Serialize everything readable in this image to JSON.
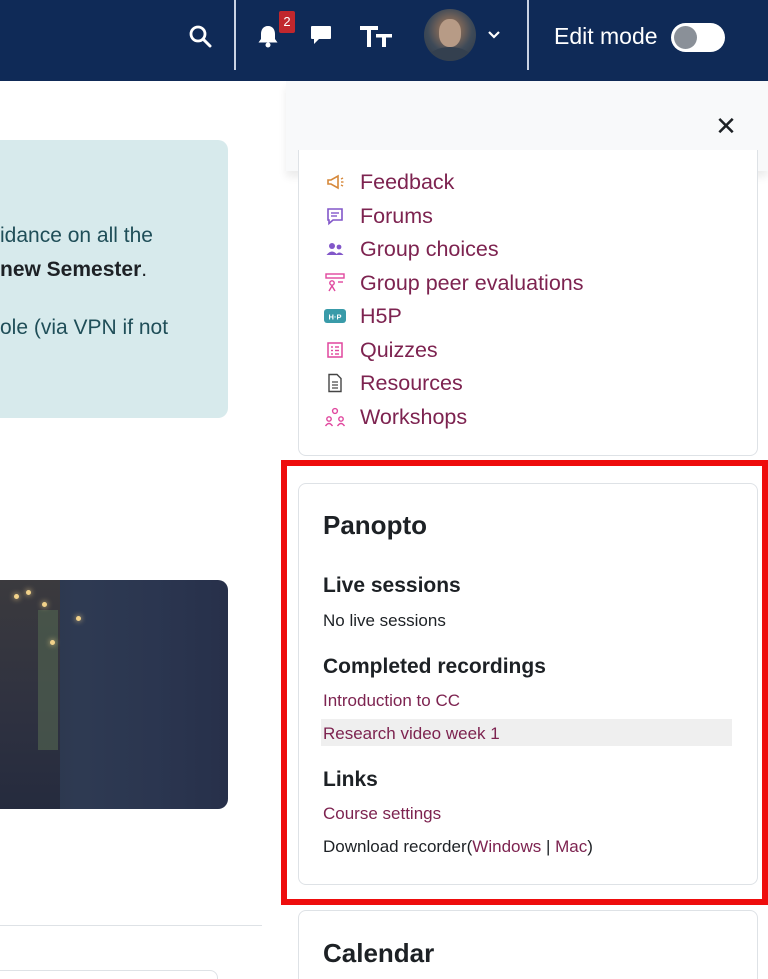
{
  "navbar": {
    "notification_count": "2",
    "edit_mode_label": "Edit mode",
    "edit_mode_on": false,
    "bg_color": "#0f2a57",
    "icons": [
      "search-icon",
      "bell-icon",
      "chat-icon",
      "text-size-icon",
      "avatar",
      "chevron-down-icon"
    ]
  },
  "notice": {
    "line1": "idance on all the",
    "line2_bold": "new Semester",
    "line2_tail": ".",
    "line3": "ole (via VPN if not"
  },
  "drawer": {
    "close_icon": "close-icon"
  },
  "activities": [
    {
      "label": "Feedback",
      "icon": "megaphone-icon"
    },
    {
      "label": "Forums",
      "icon": "forum-icon"
    },
    {
      "label": "Group choices",
      "icon": "group-icon"
    },
    {
      "label": "Group peer evaluations",
      "icon": "peer-evaluation-icon"
    },
    {
      "label": "H5P",
      "icon": "h5p-icon"
    },
    {
      "label": "Quizzes",
      "icon": "quiz-icon"
    },
    {
      "label": "Resources",
      "icon": "file-icon"
    },
    {
      "label": "Workshops",
      "icon": "workshop-icon"
    }
  ],
  "panopto": {
    "title": "Panopto",
    "live_heading": "Live sessions",
    "live_text": "No live sessions",
    "completed_heading": "Completed recordings",
    "recordings": [
      "Introduction to CC",
      "Research video week 1"
    ],
    "links_heading": "Links",
    "course_settings": "Course settings",
    "download_prefix": "Download recorder(",
    "download_windows": "Windows",
    "download_sep": " | ",
    "download_mac": "Mac",
    "download_suffix": ")"
  },
  "calendar": {
    "title": "Calendar"
  },
  "colors": {
    "link": "#7d2350",
    "highlight": "#ee0d0d",
    "notice_bg": "#d7eaec"
  }
}
